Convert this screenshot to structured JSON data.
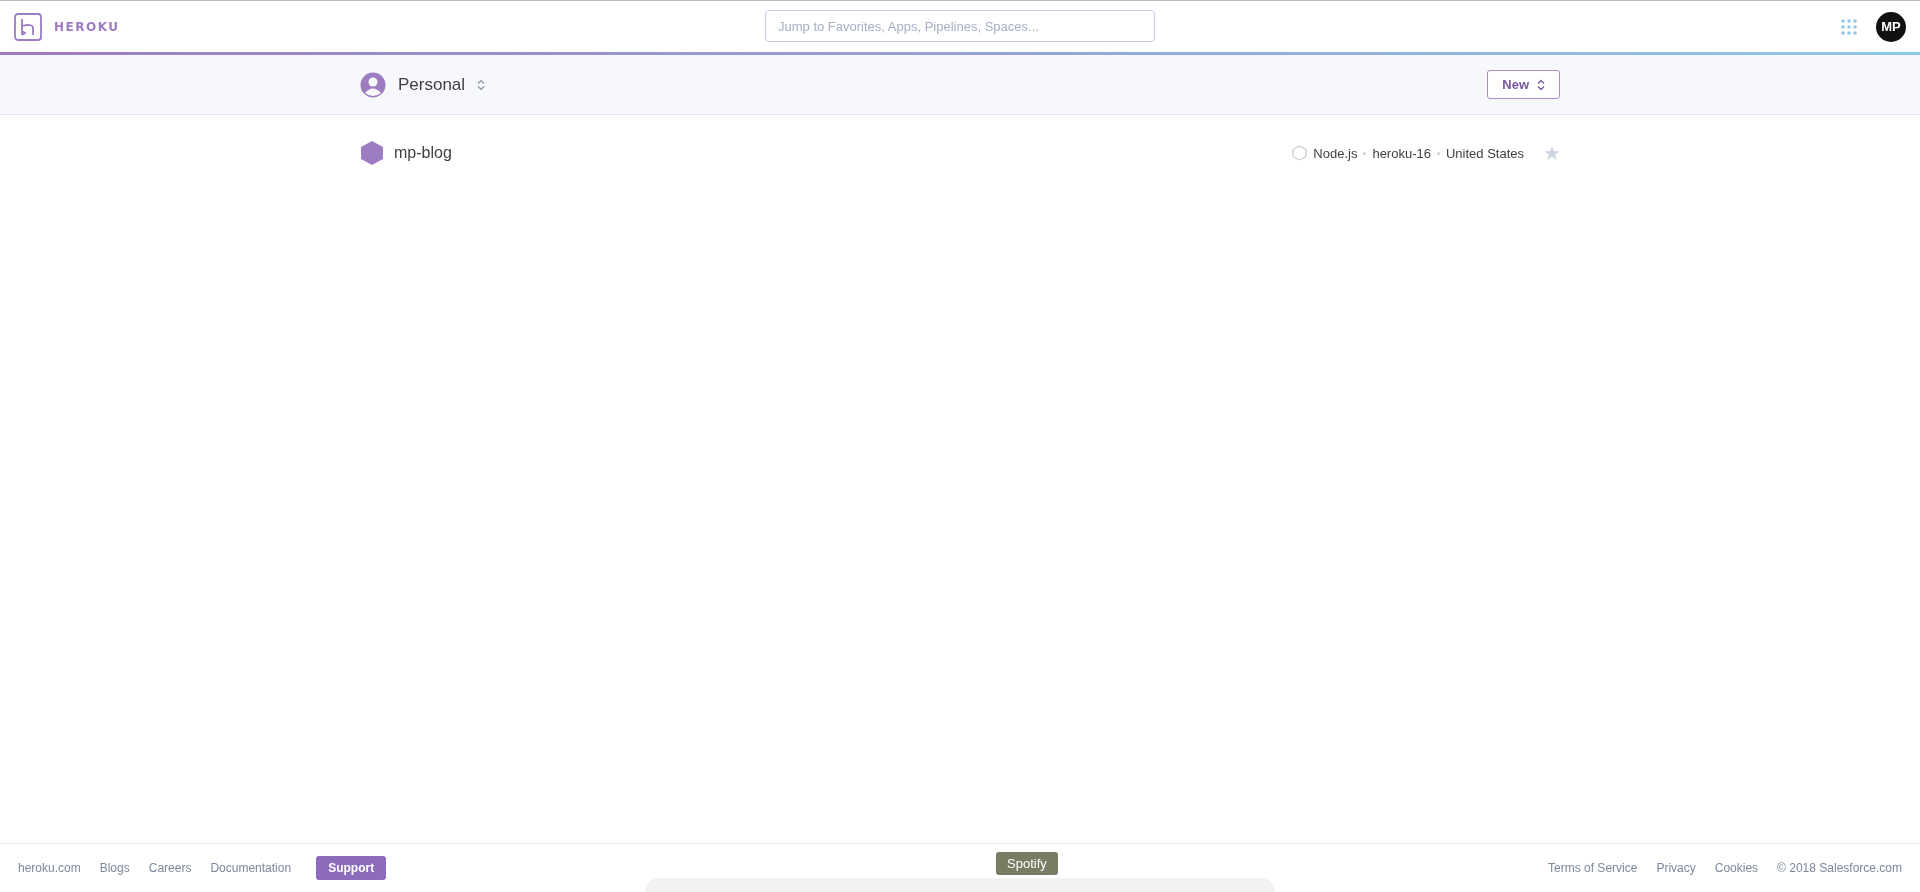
{
  "header": {
    "logo_text": "HEROKU",
    "search": {
      "placeholder": "Jump to Favorites, Apps, Pipelines, Spaces..."
    },
    "avatar_initials": "MP"
  },
  "account_bar": {
    "account": "Personal",
    "new_button": "New"
  },
  "apps": [
    {
      "name": "mp-blog",
      "stack": "Node.js",
      "stack_version": "heroku-16",
      "region": "United States",
      "favorite": false
    }
  ],
  "footer": {
    "links": [
      "heroku.com",
      "Blogs",
      "Careers",
      "Documentation"
    ],
    "support_button": "Support",
    "legal_links": [
      "Terms of Service",
      "Privacy",
      "Cookies"
    ],
    "copyright": "© 2018 Salesforce.com"
  },
  "tooltip": {
    "text": "Spotify"
  }
}
